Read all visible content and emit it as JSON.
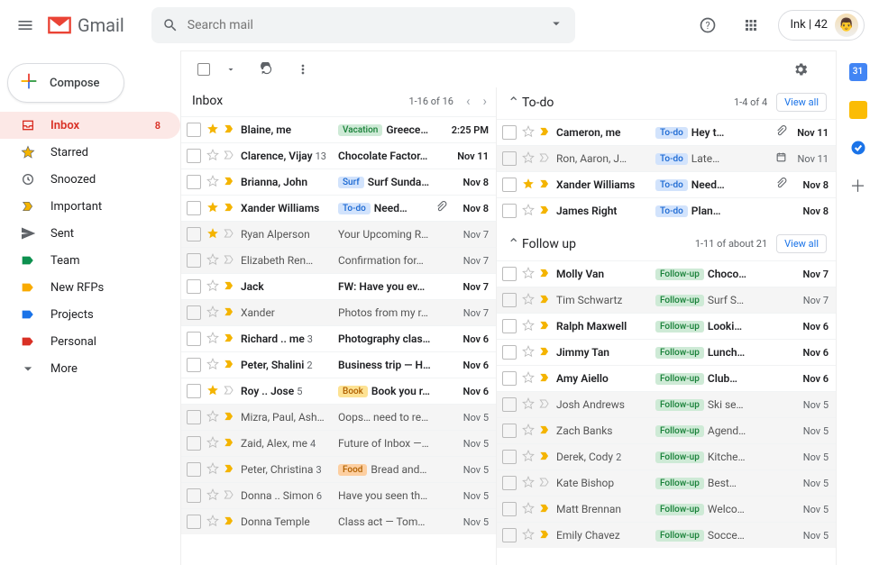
{
  "header": {
    "product": "Gmail",
    "search_placeholder": "Search mail",
    "account_label": "Ink | 42"
  },
  "compose": {
    "label": "Compose"
  },
  "folders": [
    {
      "name": "Inbox",
      "icon": "inbox",
      "active": true,
      "badge": "8"
    },
    {
      "name": "Starred",
      "icon": "star",
      "active": false
    },
    {
      "name": "Snoozed",
      "icon": "clock",
      "active": false
    },
    {
      "name": "Important",
      "icon": "important",
      "active": false
    },
    {
      "name": "Sent",
      "icon": "send",
      "active": false
    },
    {
      "name": "Team",
      "icon": "label",
      "color": "#0d904f",
      "active": false
    },
    {
      "name": "New RFPs",
      "icon": "label",
      "color": "#f9ab00",
      "active": false
    },
    {
      "name": "Projects",
      "icon": "label",
      "color": "#1a73e8",
      "active": false
    },
    {
      "name": "Personal",
      "icon": "label",
      "color": "#d93025",
      "active": false
    },
    {
      "name": "More",
      "icon": "expand",
      "active": false
    }
  ],
  "inbox_section": {
    "title": "Inbox",
    "count_text": "1-16 of 16",
    "rows": [
      {
        "unread": true,
        "starred": true,
        "important": true,
        "sender": "Blaine, me",
        "tag": "Vacation",
        "tagcls": "vacation",
        "subject": "Greece…",
        "date": "2:25 PM"
      },
      {
        "unread": true,
        "starred": false,
        "important": false,
        "sender": "Clarence, Vijay",
        "count": "13",
        "subject": "Chocolate Factor…",
        "date": "Nov 11"
      },
      {
        "unread": true,
        "starred": false,
        "important": true,
        "sender": "Brianna, John",
        "tag": "Surf",
        "tagcls": "surf",
        "subject": "Surf Sunda…",
        "date": "Nov 8"
      },
      {
        "unread": true,
        "starred": true,
        "important": true,
        "sender": "Xander Williams",
        "tag": "To-do",
        "tagcls": "todo",
        "subject": "Need…",
        "attach": true,
        "date": "Nov 8"
      },
      {
        "unread": false,
        "starred": true,
        "important": false,
        "sender": "Ryan Alperson",
        "subject": "Your Upcoming R…",
        "date": "Nov 7"
      },
      {
        "unread": false,
        "starred": false,
        "important": false,
        "sender": "Elizabeth Ren…",
        "subject": "Confirmation for…",
        "date": "Nov 7"
      },
      {
        "unread": true,
        "starred": false,
        "important": true,
        "sender": "Jack",
        "subject": "FW: Have you ev…",
        "date": "Nov 7"
      },
      {
        "unread": false,
        "starred": false,
        "important": true,
        "sender": "Xander",
        "subject": "Photos from my r…",
        "date": "Nov 7"
      },
      {
        "unread": true,
        "starred": false,
        "important": true,
        "sender": "Richard .. me",
        "count": "3",
        "subject": "Photography clas…",
        "date": "Nov 6"
      },
      {
        "unread": true,
        "starred": false,
        "important": true,
        "sender": "Peter, Shalini",
        "count": "2",
        "subject": "Business trip — H…",
        "date": "Nov 6"
      },
      {
        "unread": true,
        "starred": true,
        "important": false,
        "sender": "Roy .. Jose",
        "count": "5",
        "tag": "Book",
        "tagcls": "book",
        "subject": "Book you r…",
        "date": "Nov 6"
      },
      {
        "unread": false,
        "starred": false,
        "important": true,
        "sender": "Mizra, Paul, Ash…",
        "subject": "Oops… need to re…",
        "date": "Nov 5"
      },
      {
        "unread": false,
        "starred": false,
        "important": true,
        "sender": "Zaid, Alex, me",
        "count": "4",
        "subject": "Future of Inbox —…",
        "date": "Nov 5"
      },
      {
        "unread": false,
        "starred": false,
        "important": true,
        "sender": "Peter, Christina",
        "count": "3",
        "tag": "Food",
        "tagcls": "food",
        "subject": "Bread and…",
        "date": "Nov 5"
      },
      {
        "unread": false,
        "starred": false,
        "important": false,
        "sender": "Donna .. Simon",
        "count": "6",
        "subject": "Have you seen th…",
        "date": "Nov 5"
      },
      {
        "unread": false,
        "starred": false,
        "important": true,
        "sender": "Donna Temple",
        "subject": "Class act — Tom…",
        "date": "Nov 5"
      }
    ]
  },
  "todo_section": {
    "title": "To-do",
    "count_text": "1-4 of 4",
    "viewall": "View all",
    "rows": [
      {
        "unread": true,
        "starred": false,
        "important": true,
        "sender": "Cameron, me",
        "tag": "To-do",
        "tagcls": "todo",
        "subject": "Hey t…",
        "attach": true,
        "date": "Nov 11"
      },
      {
        "unread": false,
        "starred": false,
        "important": false,
        "sender": "Ron, Aaron, J…",
        "tag": "To-do",
        "tagcls": "todo",
        "subject": "Late…",
        "calendar": true,
        "date": "Nov 11"
      },
      {
        "unread": true,
        "starred": true,
        "important": true,
        "sender": "Xander Williams",
        "tag": "To-do",
        "tagcls": "todo",
        "subject": "Need…",
        "attach": true,
        "date": "Nov 8"
      },
      {
        "unread": true,
        "starred": false,
        "important": true,
        "sender": "James Right",
        "tag": "To-do",
        "tagcls": "todo",
        "subject": "Plan…",
        "date": "Nov 8"
      }
    ]
  },
  "followup_section": {
    "title": "Follow up",
    "count_text": "1-11 of about 21",
    "viewall": "View all",
    "rows": [
      {
        "unread": true,
        "starred": false,
        "important": true,
        "sender": "Molly Van",
        "tag": "Follow-up",
        "tagcls": "followup",
        "subject": "Choco…",
        "date": "Nov 7"
      },
      {
        "unread": false,
        "starred": false,
        "important": true,
        "sender": "Tim Schwartz",
        "tag": "Follow-up",
        "tagcls": "followup",
        "subject": "Surf S…",
        "date": "Nov 7"
      },
      {
        "unread": true,
        "starred": false,
        "important": true,
        "sender": "Ralph Maxwell",
        "tag": "Follow-up",
        "tagcls": "followup",
        "subject": "Looki…",
        "date": "Nov 6"
      },
      {
        "unread": true,
        "starred": false,
        "important": true,
        "sender": "Jimmy Tan",
        "tag": "Follow-up",
        "tagcls": "followup",
        "subject": "Lunch…",
        "date": "Nov 6"
      },
      {
        "unread": true,
        "starred": false,
        "important": true,
        "sender": "Amy Aiello",
        "tag": "Follow-up",
        "tagcls": "followup",
        "subject": "Club…",
        "date": "Nov 6"
      },
      {
        "unread": false,
        "starred": false,
        "important": false,
        "sender": "Josh Andrews",
        "tag": "Follow-up",
        "tagcls": "followup",
        "subject": "Ski se…",
        "date": "Nov 5"
      },
      {
        "unread": false,
        "starred": false,
        "important": true,
        "sender": "Zach Banks",
        "tag": "Follow-up",
        "tagcls": "followup",
        "subject": "Agend…",
        "date": "Nov 5"
      },
      {
        "unread": false,
        "starred": false,
        "important": true,
        "sender": "Derek, Cody",
        "count": "2",
        "tag": "Follow-up",
        "tagcls": "followup",
        "subject": "Kitche…",
        "date": "Nov 5"
      },
      {
        "unread": false,
        "starred": false,
        "important": false,
        "sender": "Kate Bishop",
        "tag": "Follow-up",
        "tagcls": "followup",
        "subject": "Best…",
        "date": "Nov 5"
      },
      {
        "unread": false,
        "starred": false,
        "important": true,
        "sender": "Matt Brennan",
        "tag": "Follow-up",
        "tagcls": "followup",
        "subject": "Welco…",
        "date": "Nov 5"
      },
      {
        "unread": false,
        "starred": false,
        "important": true,
        "sender": "Emily Chavez",
        "tag": "Follow-up",
        "tagcls": "followup",
        "subject": "Socce…",
        "date": "Nov 5"
      }
    ]
  }
}
